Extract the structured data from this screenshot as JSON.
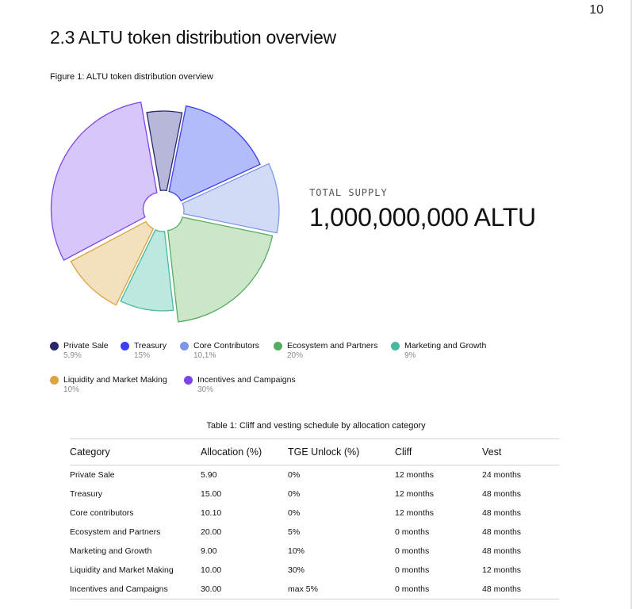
{
  "page_number": "10",
  "section_title": "2.3 ALTU token distribution overview",
  "figure_caption": "Figure 1: ALTU token distribution overview",
  "total_supply": {
    "label": "TOTAL SUPPLY",
    "value": "1,000,000,000 ALTU"
  },
  "chart_data": {
    "type": "pie",
    "title": "",
    "series": [
      {
        "name": "Private Sale",
        "value": 5.9,
        "label": "5,9%",
        "color": "#26286b",
        "fill": "#b7b8d9"
      },
      {
        "name": "Treasury",
        "value": 15,
        "label": "15%",
        "color": "#3b3ff0",
        "fill": "#b3bcfb"
      },
      {
        "name": "Core Contributors",
        "value": 10.1,
        "label": "10,1%",
        "color": "#7f95ea",
        "fill": "#d2dbf6"
      },
      {
        "name": "Ecosystem and Partners",
        "value": 20,
        "label": "20%",
        "color": "#55ad5f",
        "fill": "#cbe6c8"
      },
      {
        "name": "Marketing and Growth",
        "value": 9,
        "label": "9%",
        "color": "#46b99e",
        "fill": "#bce8df"
      },
      {
        "name": "Liquidity and Market Making",
        "value": 10,
        "label": "10%",
        "color": "#dca33f",
        "fill": "#f2e0bf"
      },
      {
        "name": "Incentives and Campaigns",
        "value": 30,
        "label": "30%",
        "color": "#7d45e8",
        "fill": "#d7c6f9"
      }
    ],
    "legend_placement": "bottom"
  },
  "table": {
    "caption": "Table 1: Cliff and vesting schedule by allocation category",
    "headers": [
      "Category",
      "Allocation (%)",
      "TGE Unlock (%)",
      "Cliff",
      "Vest"
    ],
    "rows": [
      [
        "Private Sale",
        "5.90",
        "0%",
        "12 months",
        "24 months"
      ],
      [
        "Treasury",
        "15.00",
        "0%",
        "12 months",
        "48 months"
      ],
      [
        "Core contributors",
        "10.10",
        "0%",
        "12 months",
        "48 months"
      ],
      [
        "Ecosystem and Partners",
        "20.00",
        "5%",
        "0 months",
        "48 months"
      ],
      [
        "Marketing and Growth",
        "9.00",
        "10%",
        "0 months",
        "48 months"
      ],
      [
        "Liquidity and Market Making",
        "10.00",
        "30%",
        "0 months",
        "12 months"
      ],
      [
        "Incentives and Campaigns",
        "30.00",
        "max 5%",
        "0 months",
        "48 months"
      ]
    ]
  }
}
